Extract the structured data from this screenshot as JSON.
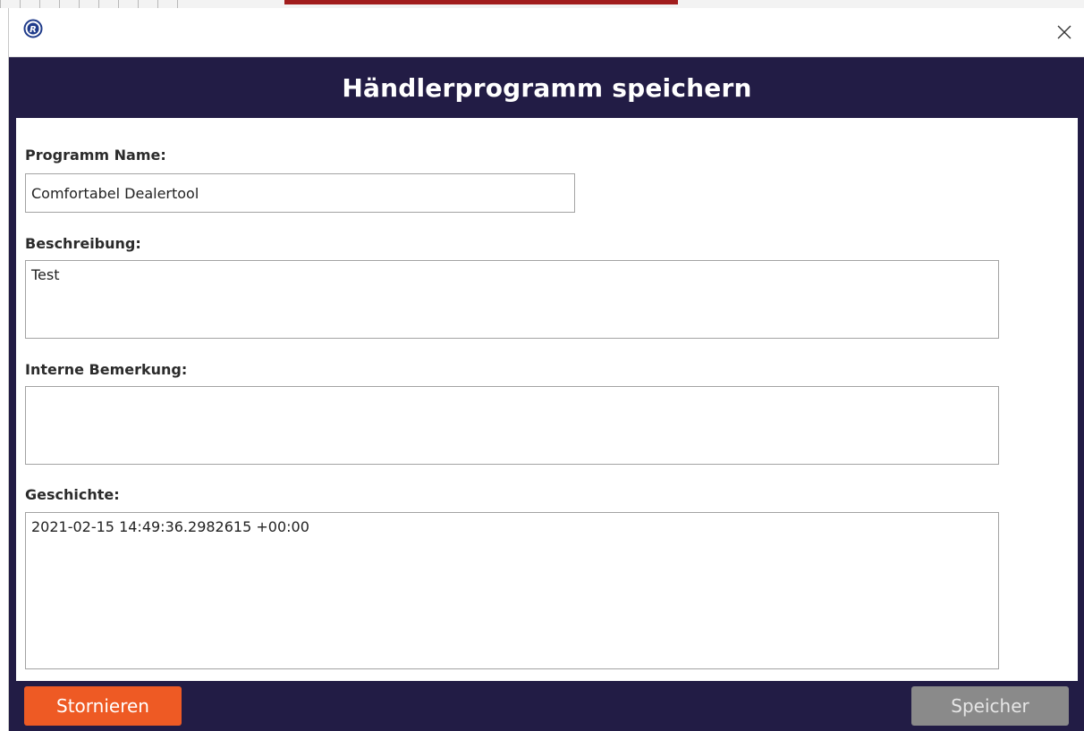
{
  "window": {
    "title": "Händlerprogramm speichern",
    "app_icon": "r-logo-icon",
    "close_glyph": "✕"
  },
  "form": {
    "name": {
      "label": "Programm Name:",
      "value": "Comfortabel Dealertool"
    },
    "description": {
      "label": "Beschreibung:",
      "value": "Test"
    },
    "internal_note": {
      "label": "Interne Bemerkung:",
      "value": ""
    },
    "history": {
      "label": "Geschichte:",
      "value": "2021-02-15 14:49:36.2982615 +00:00"
    }
  },
  "buttons": {
    "cancel": "Stornieren",
    "save": "Speicher"
  },
  "colors": {
    "header_bg": "#221c45",
    "cancel_bg": "#ee5a24",
    "save_bg": "#8a8a8a"
  }
}
